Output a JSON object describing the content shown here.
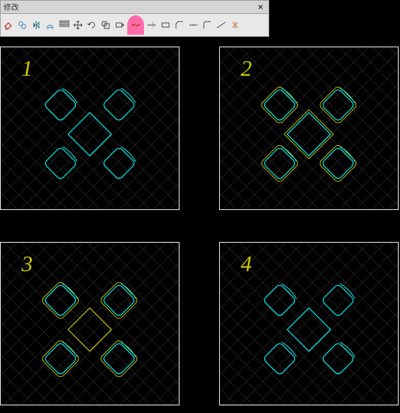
{
  "toolbar": {
    "title": "修改",
    "close": "×",
    "tools": [
      {
        "name": "erase",
        "color": "#c04040"
      },
      {
        "name": "copy",
        "color": "#4080c0"
      },
      {
        "name": "mirror",
        "color": "#008080"
      },
      {
        "name": "offset",
        "color": "#4080c0"
      },
      {
        "name": "array",
        "color": "#404040"
      },
      {
        "name": "move",
        "color": "#404040"
      },
      {
        "name": "rotate",
        "color": "#404040"
      },
      {
        "name": "scale",
        "color": "#404040"
      },
      {
        "name": "stretch",
        "color": "#404040"
      },
      {
        "name": "break",
        "color": "#c04040"
      },
      {
        "name": "trim",
        "color": "#404040"
      },
      {
        "name": "extend",
        "color": "#404040"
      },
      {
        "name": "chamfer",
        "color": "#404040"
      },
      {
        "name": "fillet",
        "color": "#404040"
      },
      {
        "name": "join",
        "color": "#404040"
      },
      {
        "name": "lengthen",
        "color": "#404040"
      },
      {
        "name": "explode",
        "color": "#c08040"
      }
    ]
  },
  "viewports": [
    {
      "label": "1",
      "chair_color": "#00ffff",
      "table_color": "#00ffff",
      "chair_fill": "none"
    },
    {
      "label": "2",
      "chair_color": "#00ffff",
      "table_color": "#00ffff",
      "chair_fill": "none",
      "outline": "#cccc00"
    },
    {
      "label": "3",
      "chair_color": "#00ffff",
      "table_color": "#cccc00",
      "chair_fill": "none",
      "outline": "#cccc00"
    },
    {
      "label": "4",
      "chair_color": "#00ffff",
      "table_color": "#00ffff",
      "chair_fill": "none"
    }
  ]
}
